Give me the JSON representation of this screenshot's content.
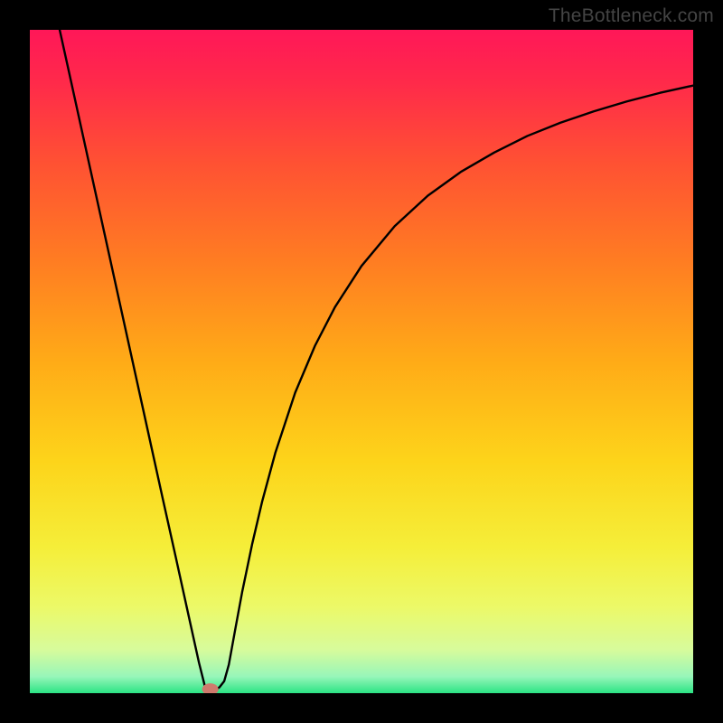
{
  "watermark": "TheBottleneck.com",
  "chart_data": {
    "type": "line",
    "title": "",
    "xlabel": "",
    "ylabel": "",
    "xlim": [
      0,
      100
    ],
    "ylim": [
      0,
      100
    ],
    "curve": {
      "x": [
        4.5,
        6,
        8,
        10,
        12,
        14,
        16,
        18,
        20,
        22,
        24,
        25.5,
        26.5,
        27.5,
        28,
        28.6,
        29.3,
        30,
        31,
        32,
        33.5,
        35,
        37,
        40,
        43,
        46,
        50,
        55,
        60,
        65,
        70,
        75,
        80,
        85,
        90,
        95,
        100
      ],
      "y": [
        100,
        93.2,
        84.1,
        75.0,
        65.9,
        56.8,
        47.7,
        38.6,
        29.5,
        20.5,
        11.4,
        4.6,
        0.6,
        0.2,
        0.5,
        0.9,
        1.8,
        4.3,
        9.8,
        15.2,
        22.4,
        28.8,
        36.2,
        45.3,
        52.4,
        58.2,
        64.4,
        70.4,
        75.0,
        78.6,
        81.5,
        84.0,
        86.0,
        87.7,
        89.2,
        90.5,
        91.6
      ]
    },
    "marker": {
      "x": 27.2,
      "y": 0.6
    },
    "gradient_stops": [
      {
        "offset": 0.0,
        "color": "#ff1758"
      },
      {
        "offset": 0.08,
        "color": "#ff2a4a"
      },
      {
        "offset": 0.2,
        "color": "#ff5133"
      },
      {
        "offset": 0.35,
        "color": "#ff7d22"
      },
      {
        "offset": 0.5,
        "color": "#ffab17"
      },
      {
        "offset": 0.65,
        "color": "#fdd41a"
      },
      {
        "offset": 0.78,
        "color": "#f5ee39"
      },
      {
        "offset": 0.87,
        "color": "#ecf968"
      },
      {
        "offset": 0.935,
        "color": "#d7fb9c"
      },
      {
        "offset": 0.975,
        "color": "#97f6b9"
      },
      {
        "offset": 1.0,
        "color": "#2be484"
      }
    ]
  }
}
